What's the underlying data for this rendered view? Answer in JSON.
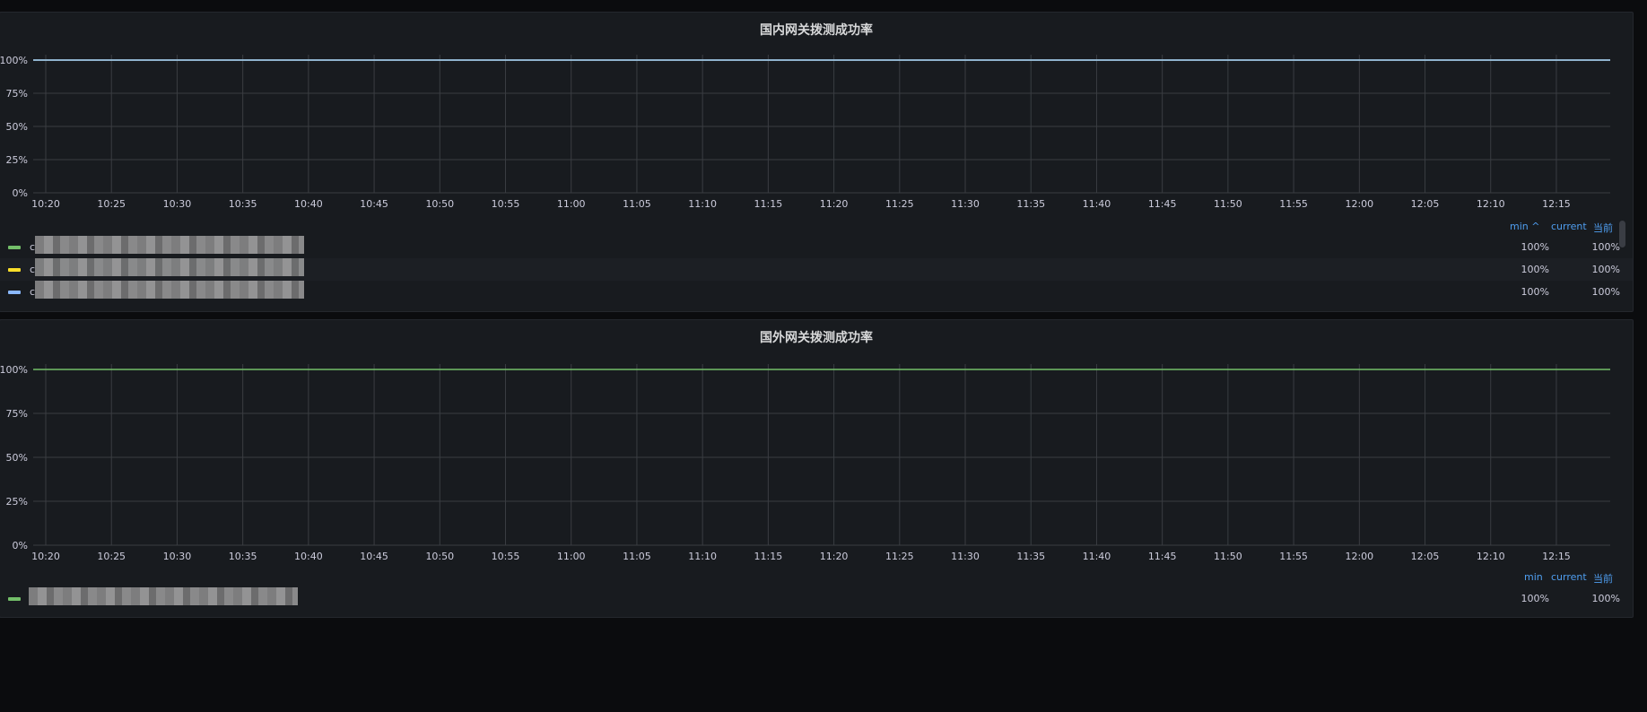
{
  "panels": [
    {
      "title": "国内网关拨测成功率",
      "legend_header": {
        "min": "min ^",
        "current": "current",
        "now": "当前"
      },
      "rows": [
        {
          "name": "c",
          "color": "#73bf69",
          "min": "100%",
          "current": "100%"
        },
        {
          "name": "c",
          "color": "#fade2a",
          "min": "100%",
          "current": "100%"
        },
        {
          "name": "c",
          "color": "#8ab8ff",
          "min": "100%",
          "current": "100%"
        }
      ]
    },
    {
      "title": "国外网关拨测成功率",
      "legend_header": {
        "min": "min",
        "current": "current",
        "now": "当前"
      },
      "rows": [
        {
          "name": "",
          "color": "#73bf69",
          "min": "100%",
          "current": "100%"
        }
      ]
    }
  ],
  "chart_data": [
    {
      "type": "line",
      "title": "国内网关拨测成功率",
      "y_ticks": [
        "0%",
        "25%",
        "50%",
        "75%",
        "100%"
      ],
      "ylim": [
        0,
        100
      ],
      "x_ticks": [
        "10:20",
        "10:25",
        "10:30",
        "10:35",
        "10:40",
        "10:45",
        "10:50",
        "10:55",
        "11:00",
        "11:05",
        "11:10",
        "11:15",
        "11:20",
        "11:25",
        "11:30",
        "11:35",
        "11:40",
        "11:45",
        "11:50",
        "11:55",
        "12:00",
        "12:05",
        "12:10",
        "12:15"
      ],
      "grid": true,
      "legend_placement": "bottom",
      "series": [
        {
          "color": "#73bf69",
          "values": [
            100,
            100,
            100,
            100,
            100,
            100,
            100,
            100,
            100,
            100,
            100,
            100,
            100,
            100,
            100,
            100,
            100,
            100,
            100,
            100,
            100,
            100,
            100,
            100
          ]
        },
        {
          "color": "#fade2a",
          "values": [
            100,
            100,
            100,
            100,
            100,
            100,
            100,
            100,
            100,
            100,
            100,
            100,
            100,
            100,
            100,
            100,
            100,
            100,
            100,
            100,
            100,
            100,
            100,
            100
          ]
        },
        {
          "color": "#8ab8ff",
          "values": [
            100,
            100,
            100,
            100,
            100,
            100,
            100,
            100,
            100,
            100,
            100,
            100,
            100,
            100,
            100,
            100,
            100,
            100,
            100,
            100,
            100,
            100,
            100,
            100
          ]
        }
      ]
    },
    {
      "type": "line",
      "title": "国外网关拨测成功率",
      "y_ticks": [
        "0%",
        "25%",
        "50%",
        "75%",
        "100%"
      ],
      "ylim": [
        0,
        100
      ],
      "x_ticks": [
        "10:20",
        "10:25",
        "10:30",
        "10:35",
        "10:40",
        "10:45",
        "10:50",
        "10:55",
        "11:00",
        "11:05",
        "11:10",
        "11:15",
        "11:20",
        "11:25",
        "11:30",
        "11:35",
        "11:40",
        "11:45",
        "11:50",
        "11:55",
        "12:00",
        "12:05",
        "12:10",
        "12:15"
      ],
      "grid": true,
      "legend_placement": "bottom",
      "series": [
        {
          "color": "#73bf69",
          "values": [
            100,
            100,
            100,
            100,
            100,
            100,
            100,
            100,
            100,
            100,
            100,
            100,
            100,
            100,
            100,
            100,
            100,
            100,
            100,
            100,
            100,
            100,
            100,
            100
          ]
        }
      ]
    }
  ]
}
